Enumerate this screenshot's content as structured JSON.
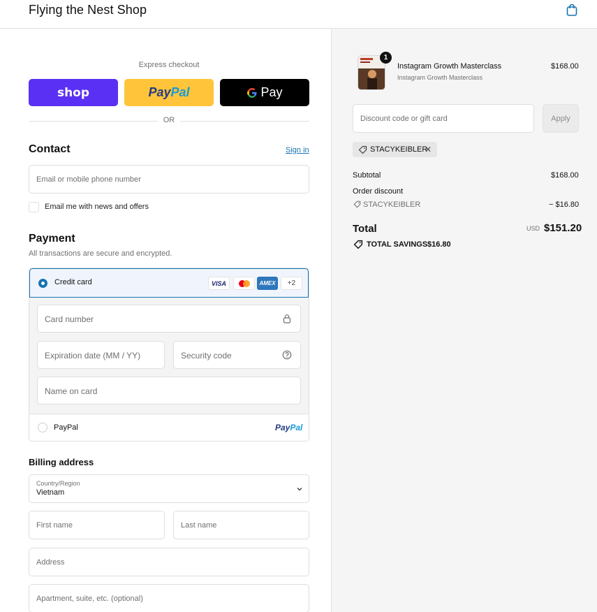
{
  "header": {
    "shop_name": "Flying the Nest Shop",
    "cart_icon": "shopping-bag-icon"
  },
  "express": {
    "label": "Express checkout",
    "shop_label": "shop",
    "paypal_pay": "Pay",
    "paypal_pal": "Pal",
    "gpay_g": "G",
    "gpay_label": "Pay",
    "or": "OR"
  },
  "contact": {
    "title": "Contact",
    "sign_in": "Sign in",
    "email_placeholder": "Email or mobile phone number",
    "news_label": "Email me with news and offers",
    "news_checked": false
  },
  "payment": {
    "title": "Payment",
    "subtitle": "All transactions are secure and encrypted.",
    "credit_card_label": "Credit card",
    "card_logos": {
      "visa": "VISA",
      "amex": "AMEX",
      "more": "+2"
    },
    "card_number_placeholder": "Card number",
    "expiration_placeholder": "Expiration date (MM / YY)",
    "security_placeholder": "Security code",
    "name_placeholder": "Name on card",
    "paypal_label": "PayPal",
    "paypal_logo_pay": "Pay",
    "paypal_logo_pal": "Pal",
    "selected": "Credit card"
  },
  "billing": {
    "title": "Billing address",
    "country_label": "Country/Region",
    "country_value": "Vietnam",
    "first_name_placeholder": "First name",
    "last_name_placeholder": "Last name",
    "address_placeholder": "Address",
    "apartment_placeholder": "Apartment, suite, etc. (optional)"
  },
  "summary": {
    "item": {
      "quantity": "1",
      "name": "Instagram Growth Masterclass",
      "variant": "Instagram Growth Masterclass",
      "price": "$168.00"
    },
    "discount_placeholder": "Discount code or gift card",
    "apply_label": "Apply",
    "applied_code": "STACYKEIBLER",
    "subtotal_label": "Subtotal",
    "subtotal_value": "$168.00",
    "order_discount_label": "Order discount",
    "order_discount_code": "STACYKEIBLER",
    "order_discount_value": "− $16.80",
    "total_label": "Total",
    "currency": "USD",
    "total_value": "$151.20",
    "savings_label": "TOTAL SAVINGS",
    "savings_value": "$16.80"
  },
  "colors": {
    "accent": "#1773b0",
    "shop_purple": "#5a31f4",
    "paypal_yellow": "#ffc439",
    "panel_bg": "#f5f5f5"
  }
}
